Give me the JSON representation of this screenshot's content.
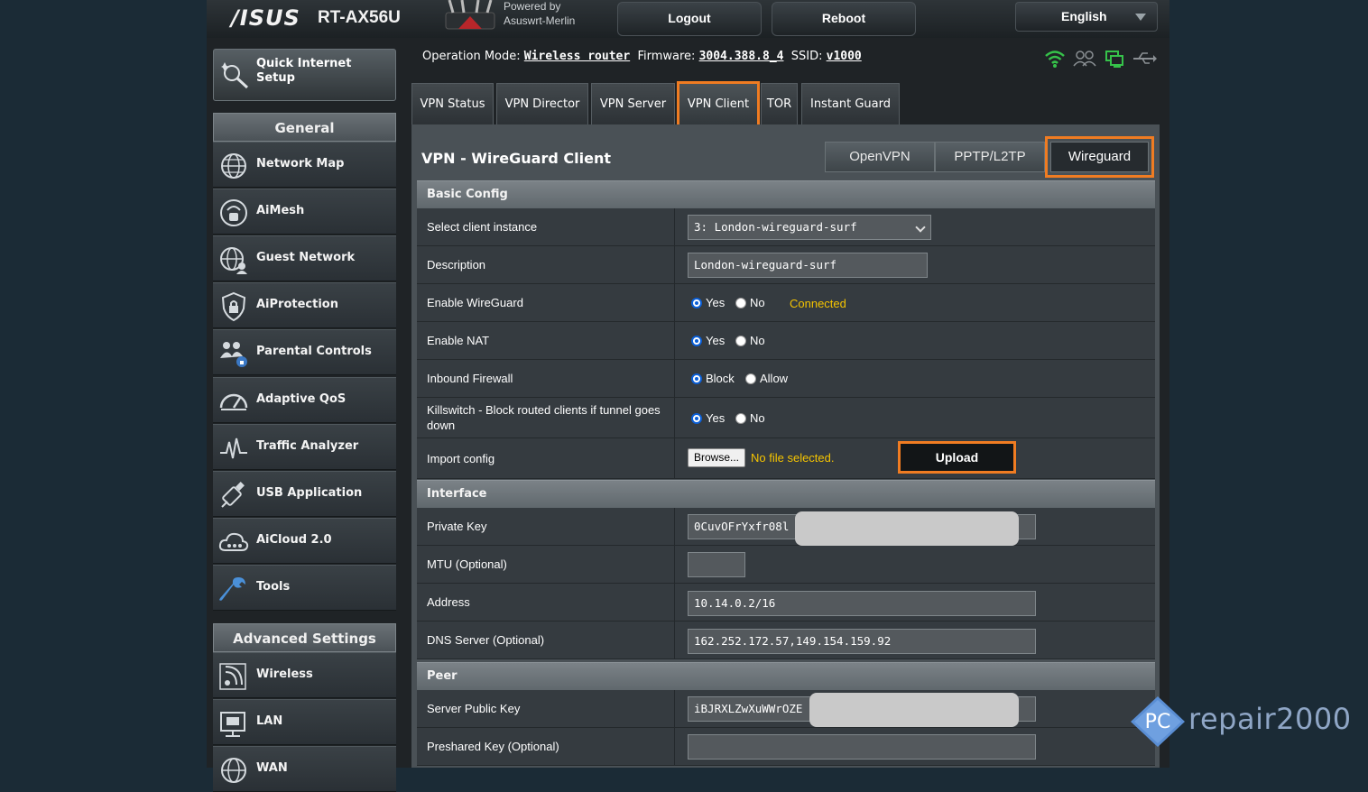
{
  "header": {
    "brand": "/ISUS",
    "model": "RT-AX56U",
    "powered_line1": "Powered by",
    "powered_line2": "Asuswrt-Merlin",
    "logout_label": "Logout",
    "reboot_label": "Reboot",
    "language": "English"
  },
  "status": {
    "op_mode_label": "Operation Mode:",
    "op_mode": "Wireless router",
    "firmware_label": "Firmware:",
    "firmware": "3004.388.8_4",
    "ssid_label": "SSID:",
    "ssid": "v1000"
  },
  "sidebar": {
    "qis_line1": "Quick Internet",
    "qis_line2": "Setup",
    "general_header": "General",
    "general_items": [
      {
        "label": "Network Map",
        "icon": "globe-icon"
      },
      {
        "label": "AiMesh",
        "icon": "aimesh-icon"
      },
      {
        "label": "Guest Network",
        "icon": "guest-network-icon"
      },
      {
        "label": "AiProtection",
        "icon": "shield-lock-icon"
      },
      {
        "label": "Parental Controls",
        "icon": "family-icon"
      },
      {
        "label": "Adaptive QoS",
        "icon": "speedometer-icon"
      },
      {
        "label": "Traffic Analyzer",
        "icon": "pulse-icon"
      },
      {
        "label": "USB Application",
        "icon": "usb-icon"
      },
      {
        "label": "AiCloud 2.0",
        "icon": "cloud-icon"
      },
      {
        "label": "Tools",
        "icon": "wrench-icon"
      }
    ],
    "advanced_header": "Advanced Settings",
    "advanced_items": [
      {
        "label": "Wireless",
        "icon": "wifi-icon"
      },
      {
        "label": "LAN",
        "icon": "lan-icon"
      },
      {
        "label": "WAN",
        "icon": "globe-icon"
      }
    ]
  },
  "tabs": [
    "VPN Status",
    "VPN Director",
    "VPN Server",
    "VPN Client",
    "TOR",
    "Instant Guard"
  ],
  "active_tab": "VPN Client",
  "page": {
    "title": "VPN - WireGuard Client",
    "protocols": [
      "OpenVPN",
      "PPTP/L2TP",
      "Wireguard"
    ],
    "selected_protocol": "Wireguard"
  },
  "basic": {
    "header": "Basic Config",
    "client_instance_label": "Select client instance",
    "client_instance_value": "3: London-wireguard-surf",
    "description_label": "Description",
    "description_value": "London-wireguard-surf",
    "enable_wg_label": "Enable WireGuard",
    "yes": "Yes",
    "no": "No",
    "connection_status": "Connected",
    "enable_nat_label": "Enable NAT",
    "inbound_fw_label": "Inbound Firewall",
    "block": "Block",
    "allow": "Allow",
    "killswitch_label": "Killswitch - Block routed clients if tunnel goes down",
    "import_label": "Import config",
    "browse_label": "Browse...",
    "no_file": "No file selected.",
    "upload_label": "Upload"
  },
  "interface": {
    "header": "Interface",
    "private_key_label": "Private Key",
    "private_key_value": "0CuvOFrYxfr08l",
    "mtu_label": "MTU (Optional)",
    "mtu_value": "",
    "address_label": "Address",
    "address_value": "10.14.0.2/16",
    "dns_label": "DNS Server (Optional)",
    "dns_value": "162.252.172.57,149.154.159.92"
  },
  "peer": {
    "header": "Peer",
    "server_key_label": "Server Public Key",
    "server_key_value": "iBJRXLZwXuWWrOZE",
    "preshared_label": "Preshared Key (Optional)",
    "preshared_value": ""
  },
  "watermark": {
    "badge": "PC",
    "text": "repair2000"
  },
  "colors": {
    "accent_orange": "#f07c22",
    "status_yellow": "#f5c400",
    "radio_blue": "#0a5fd8",
    "watermark_blue": "#8fa6c6"
  }
}
